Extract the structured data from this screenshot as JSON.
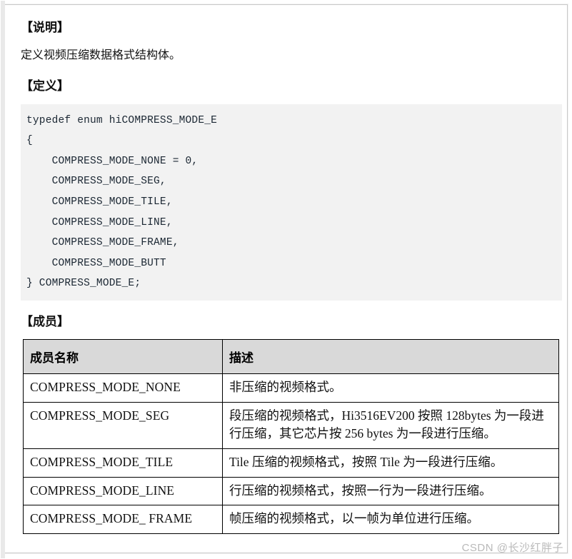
{
  "sections": {
    "description_heading": "【说明】",
    "description_text": "定义视频压缩数据格式结构体。",
    "definition_heading": "【定义】",
    "members_heading": "【成员】"
  },
  "code": {
    "language": "c",
    "text": "typedef enum hiCOMPRESS_MODE_E\n{\n    COMPRESS_MODE_NONE = 0,\n    COMPRESS_MODE_SEG,\n    COMPRESS_MODE_TILE,\n    COMPRESS_MODE_LINE,\n    COMPRESS_MODE_FRAME,\n    COMPRESS_MODE_BUTT\n} COMPRESS_MODE_E;"
  },
  "members_table": {
    "headers": [
      "成员名称",
      "描述"
    ],
    "rows": [
      {
        "name": "COMPRESS_MODE_NONE",
        "desc": "非压缩的视频格式。"
      },
      {
        "name": "COMPRESS_MODE_SEG",
        "desc": "段压缩的视频格式，Hi3516EV200 按照 128bytes 为一段进行压缩，其它芯片按 256 bytes 为一段进行压缩。"
      },
      {
        "name": "COMPRESS_MODE_TILE",
        "desc": "Tile 压缩的视频格式，按照 Tile 为一段进行压缩。"
      },
      {
        "name": "COMPRESS_MODE_LINE",
        "desc": "行压缩的视频格式，按照一行为一段进行压缩。"
      },
      {
        "name": "COMPRESS_MODE_ FRAME",
        "desc": "帧压缩的视频格式，以一帧为单位进行压缩。"
      }
    ]
  },
  "watermark": {
    "text": "CSDN @长沙红胖子"
  },
  "colors": {
    "code_background": "#f2f2f2",
    "table_header_background": "#d9d9d9",
    "table_border": "#000000",
    "watermark": "#b9b9b9"
  }
}
